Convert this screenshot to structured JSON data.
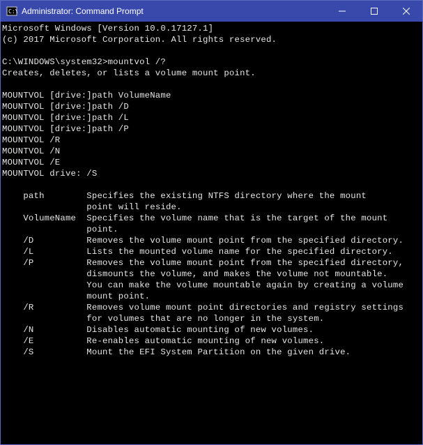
{
  "titlebar": {
    "title": "Administrator: Command Prompt"
  },
  "terminal": {
    "lines": [
      "Microsoft Windows [Version 10.0.17127.1]",
      "(c) 2017 Microsoft Corporation. All rights reserved.",
      "",
      "C:\\WINDOWS\\system32>mountvol /?",
      "Creates, deletes, or lists a volume mount point.",
      "",
      "MOUNTVOL [drive:]path VolumeName",
      "MOUNTVOL [drive:]path /D",
      "MOUNTVOL [drive:]path /L",
      "MOUNTVOL [drive:]path /P",
      "MOUNTVOL /R",
      "MOUNTVOL /N",
      "MOUNTVOL /E",
      "MOUNTVOL drive: /S",
      "",
      "    path        Specifies the existing NTFS directory where the mount",
      "                point will reside.",
      "    VolumeName  Specifies the volume name that is the target of the mount",
      "                point.",
      "    /D          Removes the volume mount point from the specified directory.",
      "    /L          Lists the mounted volume name for the specified directory.",
      "    /P          Removes the volume mount point from the specified directory,",
      "                dismounts the volume, and makes the volume not mountable.",
      "                You can make the volume mountable again by creating a volume",
      "                mount point.",
      "    /R          Removes volume mount point directories and registry settings",
      "                for volumes that are no longer in the system.",
      "    /N          Disables automatic mounting of new volumes.",
      "    /E          Re-enables automatic mounting of new volumes.",
      "    /S          Mount the EFI System Partition on the given drive."
    ]
  }
}
